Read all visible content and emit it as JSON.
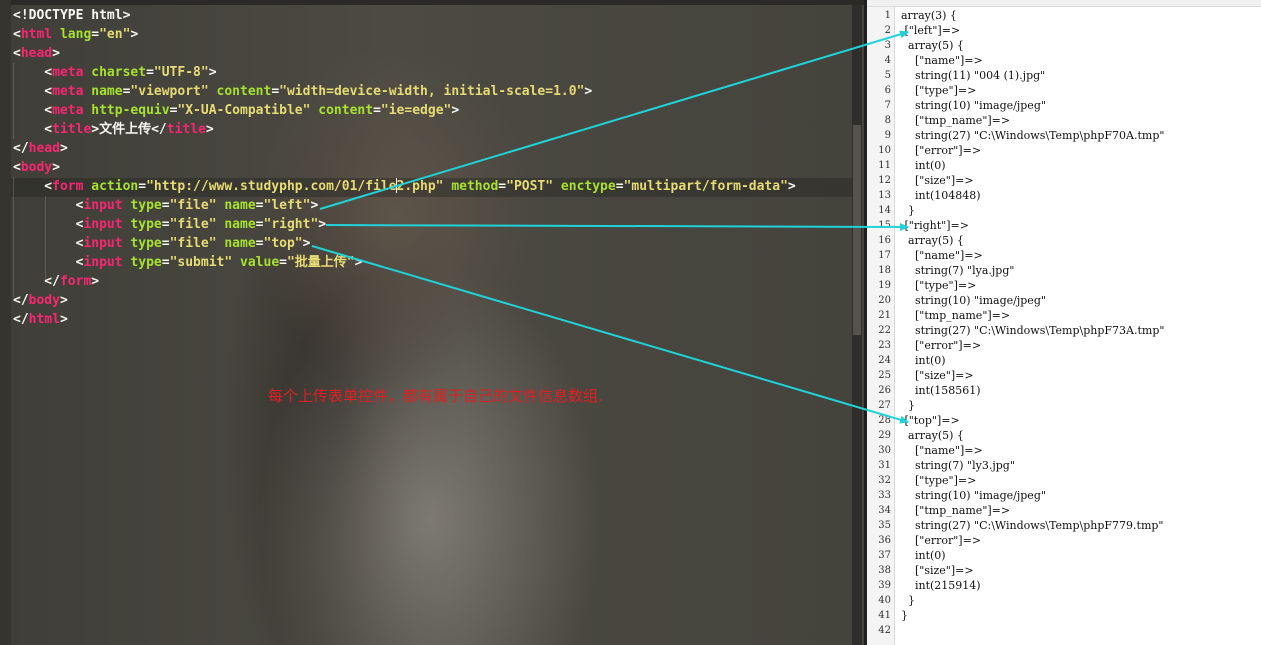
{
  "editor": {
    "lines": [
      [
        [
          "plain",
          "<!DOCTYPE html>"
        ]
      ],
      [
        [
          "plain",
          "<"
        ],
        [
          "tag",
          "html"
        ],
        [
          "plain",
          " "
        ],
        [
          "attr",
          "lang"
        ],
        [
          "plain",
          "="
        ],
        [
          "str",
          "\"en\""
        ],
        [
          "plain",
          ">"
        ]
      ],
      [
        [
          "plain",
          "<"
        ],
        [
          "tag",
          "head"
        ],
        [
          "plain",
          ">"
        ]
      ],
      [
        [
          "plain",
          "    <"
        ],
        [
          "tag",
          "meta"
        ],
        [
          "plain",
          " "
        ],
        [
          "attr",
          "charset"
        ],
        [
          "plain",
          "="
        ],
        [
          "str",
          "\"UTF-8\""
        ],
        [
          "plain",
          ">"
        ]
      ],
      [
        [
          "plain",
          "    <"
        ],
        [
          "tag",
          "meta"
        ],
        [
          "plain",
          " "
        ],
        [
          "attr",
          "name"
        ],
        [
          "plain",
          "="
        ],
        [
          "str",
          "\"viewport\""
        ],
        [
          "plain",
          " "
        ],
        [
          "attr",
          "content"
        ],
        [
          "plain",
          "="
        ],
        [
          "str",
          "\"width=device-width, initial-scale=1.0\""
        ],
        [
          "plain",
          ">"
        ]
      ],
      [
        [
          "plain",
          "    <"
        ],
        [
          "tag",
          "meta"
        ],
        [
          "plain",
          " "
        ],
        [
          "attr",
          "http-equiv"
        ],
        [
          "plain",
          "="
        ],
        [
          "str",
          "\"X-UA-Compatible\""
        ],
        [
          "plain",
          " "
        ],
        [
          "attr",
          "content"
        ],
        [
          "plain",
          "="
        ],
        [
          "str",
          "\"ie=edge\""
        ],
        [
          "plain",
          ">"
        ]
      ],
      [
        [
          "plain",
          "    <"
        ],
        [
          "tag",
          "title"
        ],
        [
          "plain",
          ">文件上传</"
        ],
        [
          "tag",
          "title"
        ],
        [
          "plain",
          ">"
        ]
      ],
      [
        [
          "plain",
          "</"
        ],
        [
          "tag",
          "head"
        ],
        [
          "plain",
          ">"
        ]
      ],
      [
        [
          "plain",
          "<"
        ],
        [
          "tag",
          "body"
        ],
        [
          "plain",
          ">"
        ]
      ],
      [
        [
          "plain",
          "    <"
        ],
        [
          "tag",
          "form"
        ],
        [
          "plain",
          " "
        ],
        [
          "attr",
          "action"
        ],
        [
          "plain",
          "="
        ],
        [
          "str",
          "\"http://www.studyphp.com/01/file"
        ],
        [
          "cursor",
          ""
        ],
        [
          "str",
          "2.php\""
        ],
        [
          "plain",
          " "
        ],
        [
          "attr",
          "method"
        ],
        [
          "plain",
          "="
        ],
        [
          "str",
          "\"POST\""
        ],
        [
          "plain",
          " "
        ],
        [
          "attr",
          "enctype"
        ],
        [
          "plain",
          "="
        ],
        [
          "str",
          "\"multipart/form-data\""
        ],
        [
          "plain",
          ">"
        ]
      ],
      [
        [
          "plain",
          "        <"
        ],
        [
          "tag",
          "input"
        ],
        [
          "plain",
          " "
        ],
        [
          "attr",
          "type"
        ],
        [
          "plain",
          "="
        ],
        [
          "str",
          "\"file\""
        ],
        [
          "plain",
          " "
        ],
        [
          "attr",
          "name"
        ],
        [
          "plain",
          "="
        ],
        [
          "str",
          "\"left\""
        ],
        [
          "plain",
          ">"
        ]
      ],
      [
        [
          "plain",
          "        <"
        ],
        [
          "tag",
          "input"
        ],
        [
          "plain",
          " "
        ],
        [
          "attr",
          "type"
        ],
        [
          "plain",
          "="
        ],
        [
          "str",
          "\"file\""
        ],
        [
          "plain",
          " "
        ],
        [
          "attr",
          "name"
        ],
        [
          "plain",
          "="
        ],
        [
          "str",
          "\"right\""
        ],
        [
          "plain",
          ">"
        ]
      ],
      [
        [
          "plain",
          "        <"
        ],
        [
          "tag",
          "input"
        ],
        [
          "plain",
          " "
        ],
        [
          "attr",
          "type"
        ],
        [
          "plain",
          "="
        ],
        [
          "str",
          "\"file\""
        ],
        [
          "plain",
          " "
        ],
        [
          "attr",
          "name"
        ],
        [
          "plain",
          "="
        ],
        [
          "str",
          "\"top\""
        ],
        [
          "plain",
          ">"
        ]
      ],
      [
        [
          "plain",
          "        <"
        ],
        [
          "tag",
          "input"
        ],
        [
          "plain",
          " "
        ],
        [
          "attr",
          "type"
        ],
        [
          "plain",
          "="
        ],
        [
          "str",
          "\"submit\""
        ],
        [
          "plain",
          " "
        ],
        [
          "attr",
          "value"
        ],
        [
          "plain",
          "="
        ],
        [
          "str",
          "\"批量上传\""
        ],
        [
          "plain",
          ">"
        ]
      ],
      [
        [
          "plain",
          "    </"
        ],
        [
          "tag",
          "form"
        ],
        [
          "plain",
          ">"
        ]
      ],
      [
        [
          "plain",
          "</"
        ],
        [
          "tag",
          "body"
        ],
        [
          "plain",
          ">"
        ]
      ],
      [
        [
          "plain",
          "</"
        ],
        [
          "tag",
          "html"
        ],
        [
          "plain",
          ">"
        ]
      ]
    ]
  },
  "annotation": "每个上传表单控件，都有属于自己的文件信息数组.",
  "output": {
    "lines": [
      "array(3) {",
      " [\"left\"]=>",
      "  array(5) {",
      "    [\"name\"]=>",
      "    string(11) \"004 (1).jpg\"",
      "    [\"type\"]=>",
      "    string(10) \"image/jpeg\"",
      "    [\"tmp_name\"]=>",
      "    string(27) \"C:\\Windows\\Temp\\phpF70A.tmp\"",
      "    [\"error\"]=>",
      "    int(0)",
      "    [\"size\"]=>",
      "    int(104848)",
      "  }",
      " [\"right\"]=>",
      "  array(5) {",
      "    [\"name\"]=>",
      "    string(7) \"lya.jpg\"",
      "    [\"type\"]=>",
      "    string(10) \"image/jpeg\"",
      "    [\"tmp_name\"]=>",
      "    string(27) \"C:\\Windows\\Temp\\phpF73A.tmp\"",
      "    [\"error\"]=>",
      "    int(0)",
      "    [\"size\"]=>",
      "    int(158561)",
      "  }",
      " [\"top\"]=>",
      "  array(5) {",
      "    [\"name\"]=>",
      "    string(7) \"ly3.jpg\"",
      "    [\"type\"]=>",
      "    string(10) \"image/jpeg\"",
      "    [\"tmp_name\"]=>",
      "    string(27) \"C:\\Windows\\Temp\\phpF779.tmp\"",
      "    [\"error\"]=>",
      "    int(0)",
      "    [\"size\"]=>",
      "    int(215914)",
      "  }",
      "}",
      ""
    ]
  },
  "colors": {
    "tag": "#f92672",
    "attr": "#a6e22e",
    "string": "#e6db74",
    "arrow": "#1fd3d8",
    "annotation": "#e02020"
  }
}
